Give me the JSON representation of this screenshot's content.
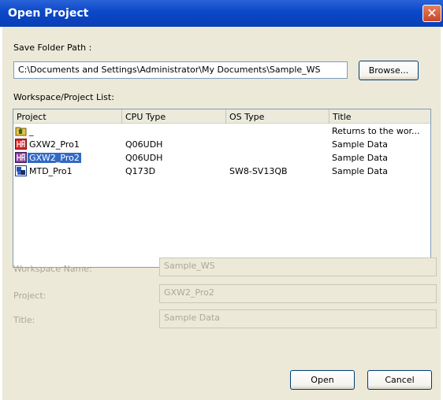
{
  "window": {
    "title": "Open Project",
    "close_glyph": "✕"
  },
  "save_folder": {
    "label": "Save Folder Path :",
    "path": "C:\\Documents and Settings\\Administrator\\My Documents\\Sample_WS",
    "browse_label": "Browse..."
  },
  "list": {
    "label": "Workspace/Project List:",
    "columns": [
      "Project",
      "CPU Type",
      "OS Type",
      "Title"
    ],
    "rows": [
      {
        "icon": "up-folder-icon",
        "project": "_",
        "cpu": "",
        "os": "",
        "title": "Returns to the wor..."
      },
      {
        "icon": "gx-project-icon",
        "project": "GXW2_Pro1",
        "cpu": "Q06UDH",
        "os": "",
        "title": "Sample Data"
      },
      {
        "icon": "gx-project-icon",
        "project": "GXW2_Pro2",
        "cpu": "Q06UDH",
        "os": "",
        "title": "Sample Data",
        "selected": true
      },
      {
        "icon": "mt-project-icon",
        "project": "MTD_Pro1",
        "cpu": "Q173D",
        "os": "SW8-SV13QB",
        "title": "Sample Data"
      }
    ]
  },
  "fields": {
    "workspace_name_label": "Workspace Name:",
    "workspace_name_value": "Sample_WS",
    "project_label": "Project:",
    "project_value": "GXW2_Pro2",
    "title_label": "Title:",
    "title_value": "Sample Data"
  },
  "buttons": {
    "open_label": "Open",
    "cancel_label": "Cancel"
  },
  "colors": {
    "titlebar": "#0b47c9",
    "selection": "#316ac5",
    "dialog_bg": "#ece9d8"
  }
}
